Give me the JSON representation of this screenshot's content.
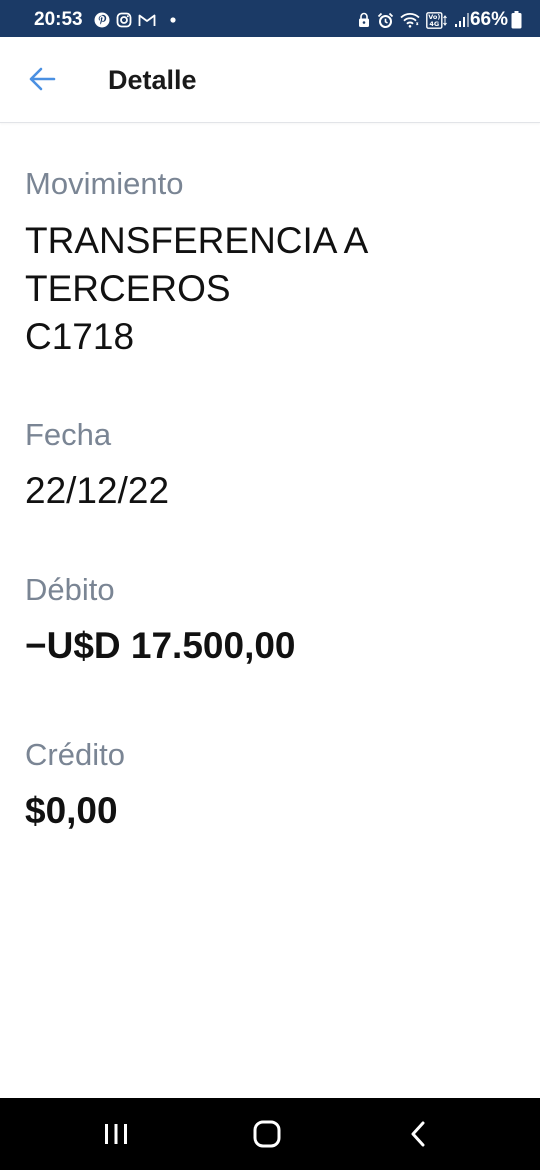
{
  "status_bar": {
    "time": "20:53",
    "battery": "66%",
    "left_icons": [
      "pinterest-icon",
      "instagram-icon",
      "gmail-icon",
      "dot-icon"
    ],
    "right_icons": [
      "lock-icon",
      "alarm-icon",
      "wifi-icon",
      "volte-icon",
      "signal-icon",
      "battery-icon"
    ],
    "network_label": "Vo) 4G"
  },
  "header": {
    "title": "Detalle",
    "back_icon": "arrow-left-icon"
  },
  "details": {
    "movimiento": {
      "label": "Movimiento",
      "value": "TRANSFERENCIA A\nTERCEROS\nC1718"
    },
    "fecha": {
      "label": "Fecha",
      "value": "22/12/22"
    },
    "debito": {
      "label": "Débito",
      "value": "−U$D 17.500,00"
    },
    "credito": {
      "label": "Crédito",
      "value": "$0,00"
    }
  },
  "nav_bar": {
    "buttons": [
      "recents-icon",
      "home-icon",
      "back-icon"
    ]
  },
  "colors": {
    "status_bar_bg": "#1b3a66",
    "accent": "#4a90e2",
    "label": "#7a8594",
    "value": "#111111"
  }
}
